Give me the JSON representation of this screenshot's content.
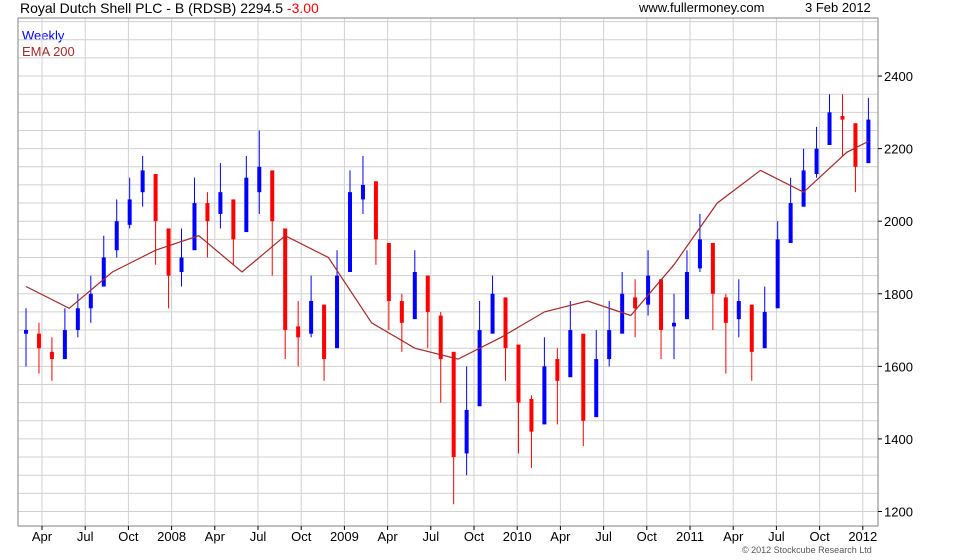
{
  "header": {
    "title": "Royal Dutch Shell PLC - B (RDSB)",
    "price": "2294.5",
    "change": "-3.00",
    "website": "www.fullermoney.com",
    "date": "3 Feb 2012"
  },
  "legend": {
    "weekly": "Weekly",
    "ema": "EMA 200"
  },
  "copyright": "© 2012 Stockcube Research Ltd",
  "colors": {
    "up": "#0000ff",
    "down": "#ff0000",
    "ema": "#a52a2a",
    "change": "#ff0000",
    "grid": "#d0d0d0"
  },
  "chart_data": {
    "type": "candlestick",
    "title": "Royal Dutch Shell PLC - B (RDSB)",
    "x_ticks": [
      "Apr",
      "Jul",
      "Oct",
      "2008",
      "Apr",
      "Jul",
      "Oct",
      "2009",
      "Apr",
      "Jul",
      "Oct",
      "2010",
      "Apr",
      "Jul",
      "Oct",
      "2011",
      "Apr",
      "Jul",
      "Oct",
      "2012"
    ],
    "ylim": [
      1160,
      2560
    ],
    "y_ticks": [
      1200,
      1400,
      1600,
      1800,
      2000,
      2200,
      2400
    ],
    "y_axis_position": "right",
    "grid": true,
    "legend_position": "top-left",
    "series": [
      {
        "name": "Weekly",
        "type": "candlestick",
        "x": [
          0.0,
          0.3,
          0.6,
          0.9,
          1.2,
          1.5,
          1.8,
          2.1,
          2.4,
          2.7,
          3.0,
          3.3,
          3.6,
          3.9,
          4.2,
          4.5,
          4.8,
          5.1,
          5.4,
          5.7,
          6.0,
          6.3,
          6.6,
          6.9,
          7.2,
          7.5,
          7.8,
          8.1,
          8.4,
          8.7,
          9.0,
          9.3,
          9.6,
          9.9,
          10.2,
          10.5,
          10.8,
          11.1,
          11.4,
          11.7,
          12.0,
          12.3,
          12.6,
          12.9,
          13.2,
          13.5,
          13.8,
          14.1,
          14.4,
          14.7,
          15.0,
          15.3,
          15.6,
          15.9,
          16.2,
          16.5,
          16.8,
          17.1,
          17.4,
          17.7,
          18.0,
          18.3,
          18.6,
          18.9,
          19.2,
          19.5
        ],
        "close": [
          1700,
          1650,
          1620,
          1700,
          1760,
          1800,
          1900,
          2000,
          2060,
          2140,
          2000,
          1850,
          1900,
          2050,
          2000,
          2080,
          1950,
          2120,
          2150,
          2000,
          1700,
          1680,
          1780,
          1620,
          1850,
          2080,
          2100,
          1950,
          1780,
          1720,
          1860,
          1750,
          1620,
          1350,
          1480,
          1700,
          1800,
          1650,
          1500,
          1420,
          1600,
          1560,
          1700,
          1450,
          1620,
          1700,
          1800,
          1760,
          1850,
          1700,
          1720,
          1860,
          1950,
          1800,
          1720,
          1780,
          1640,
          1750,
          1950,
          2050,
          2140,
          2200,
          2300,
          2280,
          2150,
          2280
        ],
        "high": [
          1760,
          1720,
          1680,
          1760,
          1800,
          1850,
          1960,
          2060,
          2120,
          2180,
          2100,
          1950,
          1980,
          2120,
          2080,
          2160,
          2060,
          2180,
          2250,
          2120,
          1820,
          1780,
          1850,
          1740,
          1920,
          2140,
          2180,
          2080,
          1880,
          1800,
          1920,
          1850,
          1750,
          1480,
          1600,
          1780,
          1850,
          1780,
          1600,
          1520,
          1680,
          1650,
          1780,
          1560,
          1700,
          1780,
          1860,
          1840,
          1920,
          1800,
          1800,
          1920,
          2020,
          1900,
          1800,
          1840,
          1760,
          1820,
          2000,
          2120,
          2200,
          2260,
          2350,
          2350,
          2250,
          2340
        ],
        "low": [
          1600,
          1580,
          1560,
          1620,
          1680,
          1720,
          1820,
          1900,
          1980,
          2040,
          1880,
          1760,
          1820,
          1950,
          1900,
          1980,
          1880,
          2040,
          2020,
          1850,
          1620,
          1600,
          1680,
          1560,
          1780,
          1980,
          2020,
          1880,
          1700,
          1640,
          1760,
          1650,
          1500,
          1220,
          1300,
          1560,
          1700,
          1560,
          1360,
          1320,
          1480,
          1440,
          1580,
          1380,
          1520,
          1600,
          1700,
          1680,
          1740,
          1620,
          1620,
          1780,
          1860,
          1700,
          1580,
          1680,
          1560,
          1650,
          1860,
          1960,
          2060,
          2120,
          2220,
          2180,
          2080,
          2200
        ],
        "open": [
          1690,
          1690,
          1640,
          1620,
          1700,
          1760,
          1820,
          1920,
          1990,
          2080,
          2130,
          1980,
          1860,
          1920,
          2050,
          2020,
          2060,
          1970,
          2080,
          2140,
          1980,
          1710,
          1690,
          1770,
          1650,
          1860,
          2060,
          2110,
          1940,
          1780,
          1730,
          1850,
          1740,
          1640,
          1360,
          1490,
          1690,
          1790,
          1660,
          1510,
          1440,
          1620,
          1570,
          1690,
          1460,
          1620,
          1690,
          1790,
          1770,
          1840,
          1710,
          1730,
          1870,
          1940,
          1790,
          1730,
          1770,
          1650,
          1760,
          1940,
          2040,
          2130,
          2210,
          2290,
          2270,
          2160
        ]
      },
      {
        "name": "EMA 200",
        "type": "line",
        "x": [
          0,
          1,
          2,
          3,
          4,
          5,
          6,
          7,
          8,
          9,
          10,
          11,
          12,
          13,
          14,
          15,
          16,
          17,
          18,
          19,
          19.5
        ],
        "values": [
          1820,
          1760,
          1860,
          1920,
          1960,
          1860,
          1960,
          1900,
          1720,
          1650,
          1620,
          1680,
          1750,
          1780,
          1740,
          1880,
          2050,
          2140,
          2080,
          2190,
          2220
        ]
      }
    ]
  }
}
